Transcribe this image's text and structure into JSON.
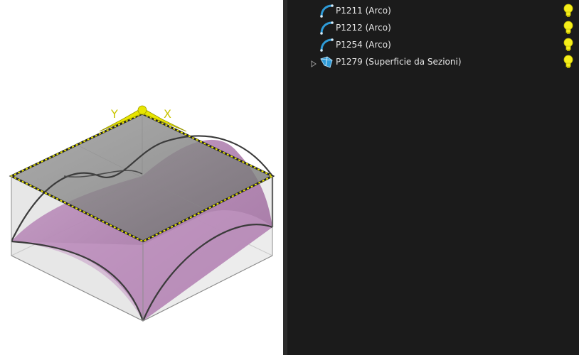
{
  "viewport": {
    "axis_y_label": "Y",
    "axis_x_label": "X"
  },
  "tree": {
    "items": [
      {
        "label": "P1211 (Arco)",
        "icon": "arc-icon",
        "expandable": false,
        "visible": true
      },
      {
        "label": "P1212 (Arco)",
        "icon": "arc-icon",
        "expandable": false,
        "visible": true
      },
      {
        "label": "P1254 (Arco)",
        "icon": "arc-icon",
        "expandable": false,
        "visible": true
      },
      {
        "label": "P1279 (Superficie da Sezioni)",
        "icon": "surface-icon",
        "expandable": true,
        "visible": true
      }
    ]
  },
  "colors": {
    "panel_bg": "#1b1b1b",
    "surface_fill": "#b084b0",
    "box_top": "#7a7a7a",
    "highlight_yellow": "#e8e500",
    "bulb_yellow": "#f5ee1a",
    "icon_blue": "#2e9bd8"
  }
}
